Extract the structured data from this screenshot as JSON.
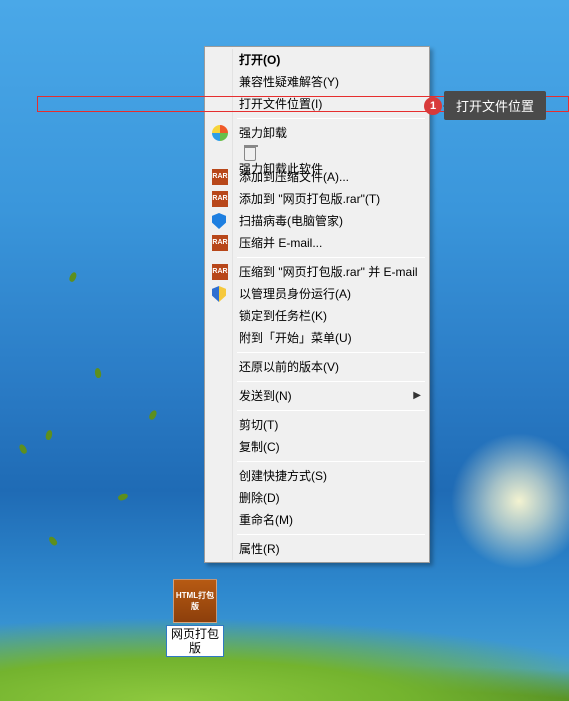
{
  "desktop_icon": {
    "tile_text": "HTML打包版",
    "label": "网页打包版"
  },
  "context_menu": {
    "items": [
      {
        "type": "item",
        "label": "打开(O)",
        "bold": true
      },
      {
        "type": "item",
        "label": "兼容性疑难解答(Y)"
      },
      {
        "type": "item",
        "label": "打开文件位置(I)"
      },
      {
        "type": "sep"
      },
      {
        "type": "item",
        "label": "强力卸载",
        "icon": "icon-360"
      },
      {
        "type": "item",
        "label": "强力卸载此软件",
        "icon": "icon-trash"
      },
      {
        "type": "item",
        "label": "添加到压缩文件(A)...",
        "icon": "icon-rar",
        "icon_text": "RAR"
      },
      {
        "type": "item",
        "label": "添加到 \"网页打包版.rar\"(T)",
        "icon": "icon-rar",
        "icon_text": "RAR"
      },
      {
        "type": "item",
        "label": "扫描病毒(电脑管家)",
        "icon": "icon-shield"
      },
      {
        "type": "item",
        "label": "压缩并 E-mail...",
        "icon": "icon-rar",
        "icon_text": "RAR"
      },
      {
        "type": "sep"
      },
      {
        "type": "item",
        "label": "压缩到 \"网页打包版.rar\" 并 E-mail",
        "icon": "icon-rar",
        "icon_text": "RAR"
      },
      {
        "type": "item",
        "label": "以管理员身份运行(A)",
        "icon": "icon-shield yb"
      },
      {
        "type": "item",
        "label": "锁定到任务栏(K)"
      },
      {
        "type": "item",
        "label": "附到「开始」菜单(U)"
      },
      {
        "type": "sep"
      },
      {
        "type": "item",
        "label": "还原以前的版本(V)"
      },
      {
        "type": "sep"
      },
      {
        "type": "item",
        "label": "发送到(N)",
        "submenu": true
      },
      {
        "type": "sep"
      },
      {
        "type": "item",
        "label": "剪切(T)"
      },
      {
        "type": "item",
        "label": "复制(C)"
      },
      {
        "type": "sep"
      },
      {
        "type": "item",
        "label": "创建快捷方式(S)"
      },
      {
        "type": "item",
        "label": "删除(D)"
      },
      {
        "type": "item",
        "label": "重命名(M)"
      },
      {
        "type": "sep"
      },
      {
        "type": "item",
        "label": "属性(R)"
      }
    ]
  },
  "annotation": {
    "badge_number": "1",
    "tooltip_text": "打开文件位置"
  }
}
